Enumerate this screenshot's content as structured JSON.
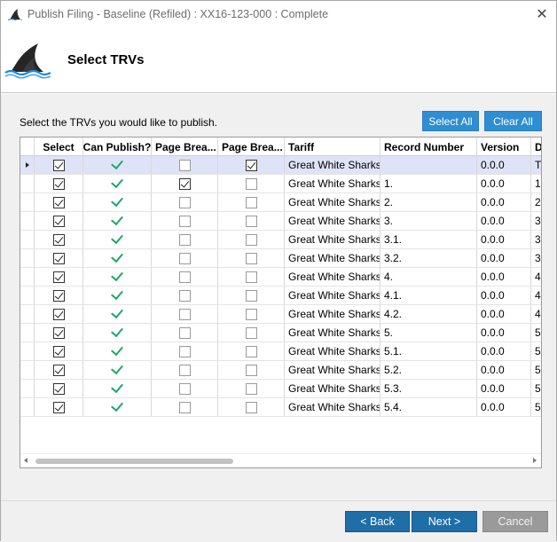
{
  "window": {
    "title": "Publish Filing - Baseline (Refiled) : XX16-123-000 : Complete",
    "close_glyph": "✕"
  },
  "header": {
    "heading": "Select TRVs",
    "logo_icon": "shark-fin-logo-icon"
  },
  "content": {
    "instruction": "Select the TRVs you would like to publish.",
    "select_all_label": "Select All",
    "clear_all_label": "Clear All"
  },
  "grid": {
    "columns": [
      "Select",
      "Can Publish?",
      "Page Brea...",
      "Page Brea...",
      "Tariff",
      "Record Number",
      "Version",
      "D"
    ],
    "rows": [
      {
        "select": true,
        "can_publish": true,
        "page_break_1": false,
        "page_break_2": true,
        "tariff": "Great White Sharks",
        "record_number": "",
        "version": "0.0.0",
        "d": "T",
        "current": true
      },
      {
        "select": true,
        "can_publish": true,
        "page_break_1": true,
        "page_break_2": false,
        "tariff": "Great White Sharks",
        "record_number": "1.",
        "version": "0.0.0",
        "d": "1",
        "current": false
      },
      {
        "select": true,
        "can_publish": true,
        "page_break_1": false,
        "page_break_2": false,
        "tariff": "Great White Sharks",
        "record_number": "2.",
        "version": "0.0.0",
        "d": "2",
        "current": false
      },
      {
        "select": true,
        "can_publish": true,
        "page_break_1": false,
        "page_break_2": false,
        "tariff": "Great White Sharks",
        "record_number": "3.",
        "version": "0.0.0",
        "d": "3",
        "current": false
      },
      {
        "select": true,
        "can_publish": true,
        "page_break_1": false,
        "page_break_2": false,
        "tariff": "Great White Sharks",
        "record_number": "3.1.",
        "version": "0.0.0",
        "d": "3",
        "current": false
      },
      {
        "select": true,
        "can_publish": true,
        "page_break_1": false,
        "page_break_2": false,
        "tariff": "Great White Sharks",
        "record_number": "3.2.",
        "version": "0.0.0",
        "d": "3",
        "current": false
      },
      {
        "select": true,
        "can_publish": true,
        "page_break_1": false,
        "page_break_2": false,
        "tariff": "Great White Sharks",
        "record_number": "4.",
        "version": "0.0.0",
        "d": "4",
        "current": false
      },
      {
        "select": true,
        "can_publish": true,
        "page_break_1": false,
        "page_break_2": false,
        "tariff": "Great White Sharks",
        "record_number": "4.1.",
        "version": "0.0.0",
        "d": "4",
        "current": false
      },
      {
        "select": true,
        "can_publish": true,
        "page_break_1": false,
        "page_break_2": false,
        "tariff": "Great White Sharks",
        "record_number": "4.2.",
        "version": "0.0.0",
        "d": "4",
        "current": false
      },
      {
        "select": true,
        "can_publish": true,
        "page_break_1": false,
        "page_break_2": false,
        "tariff": "Great White Sharks",
        "record_number": "5.",
        "version": "0.0.0",
        "d": "5",
        "current": false
      },
      {
        "select": true,
        "can_publish": true,
        "page_break_1": false,
        "page_break_2": false,
        "tariff": "Great White Sharks",
        "record_number": "5.1.",
        "version": "0.0.0",
        "d": "5",
        "current": false
      },
      {
        "select": true,
        "can_publish": true,
        "page_break_1": false,
        "page_break_2": false,
        "tariff": "Great White Sharks",
        "record_number": "5.2.",
        "version": "0.0.0",
        "d": "5",
        "current": false
      },
      {
        "select": true,
        "can_publish": true,
        "page_break_1": false,
        "page_break_2": false,
        "tariff": "Great White Sharks",
        "record_number": "5.3.",
        "version": "0.0.0",
        "d": "5",
        "current": false
      },
      {
        "select": true,
        "can_publish": true,
        "page_break_1": false,
        "page_break_2": false,
        "tariff": "Great White Sharks",
        "record_number": "5.4.",
        "version": "0.0.0",
        "d": "5",
        "current": false
      }
    ]
  },
  "footer": {
    "back_label": "< Back",
    "next_label": "Next >",
    "cancel_label": "Cancel"
  },
  "colors": {
    "accent_button": "#2e8ed3",
    "nav_button": "#1e6ea7",
    "cancel_button": "#9a9a9a",
    "publish_tick": "#1aa86a",
    "selected_row": "#dfe3f7"
  }
}
